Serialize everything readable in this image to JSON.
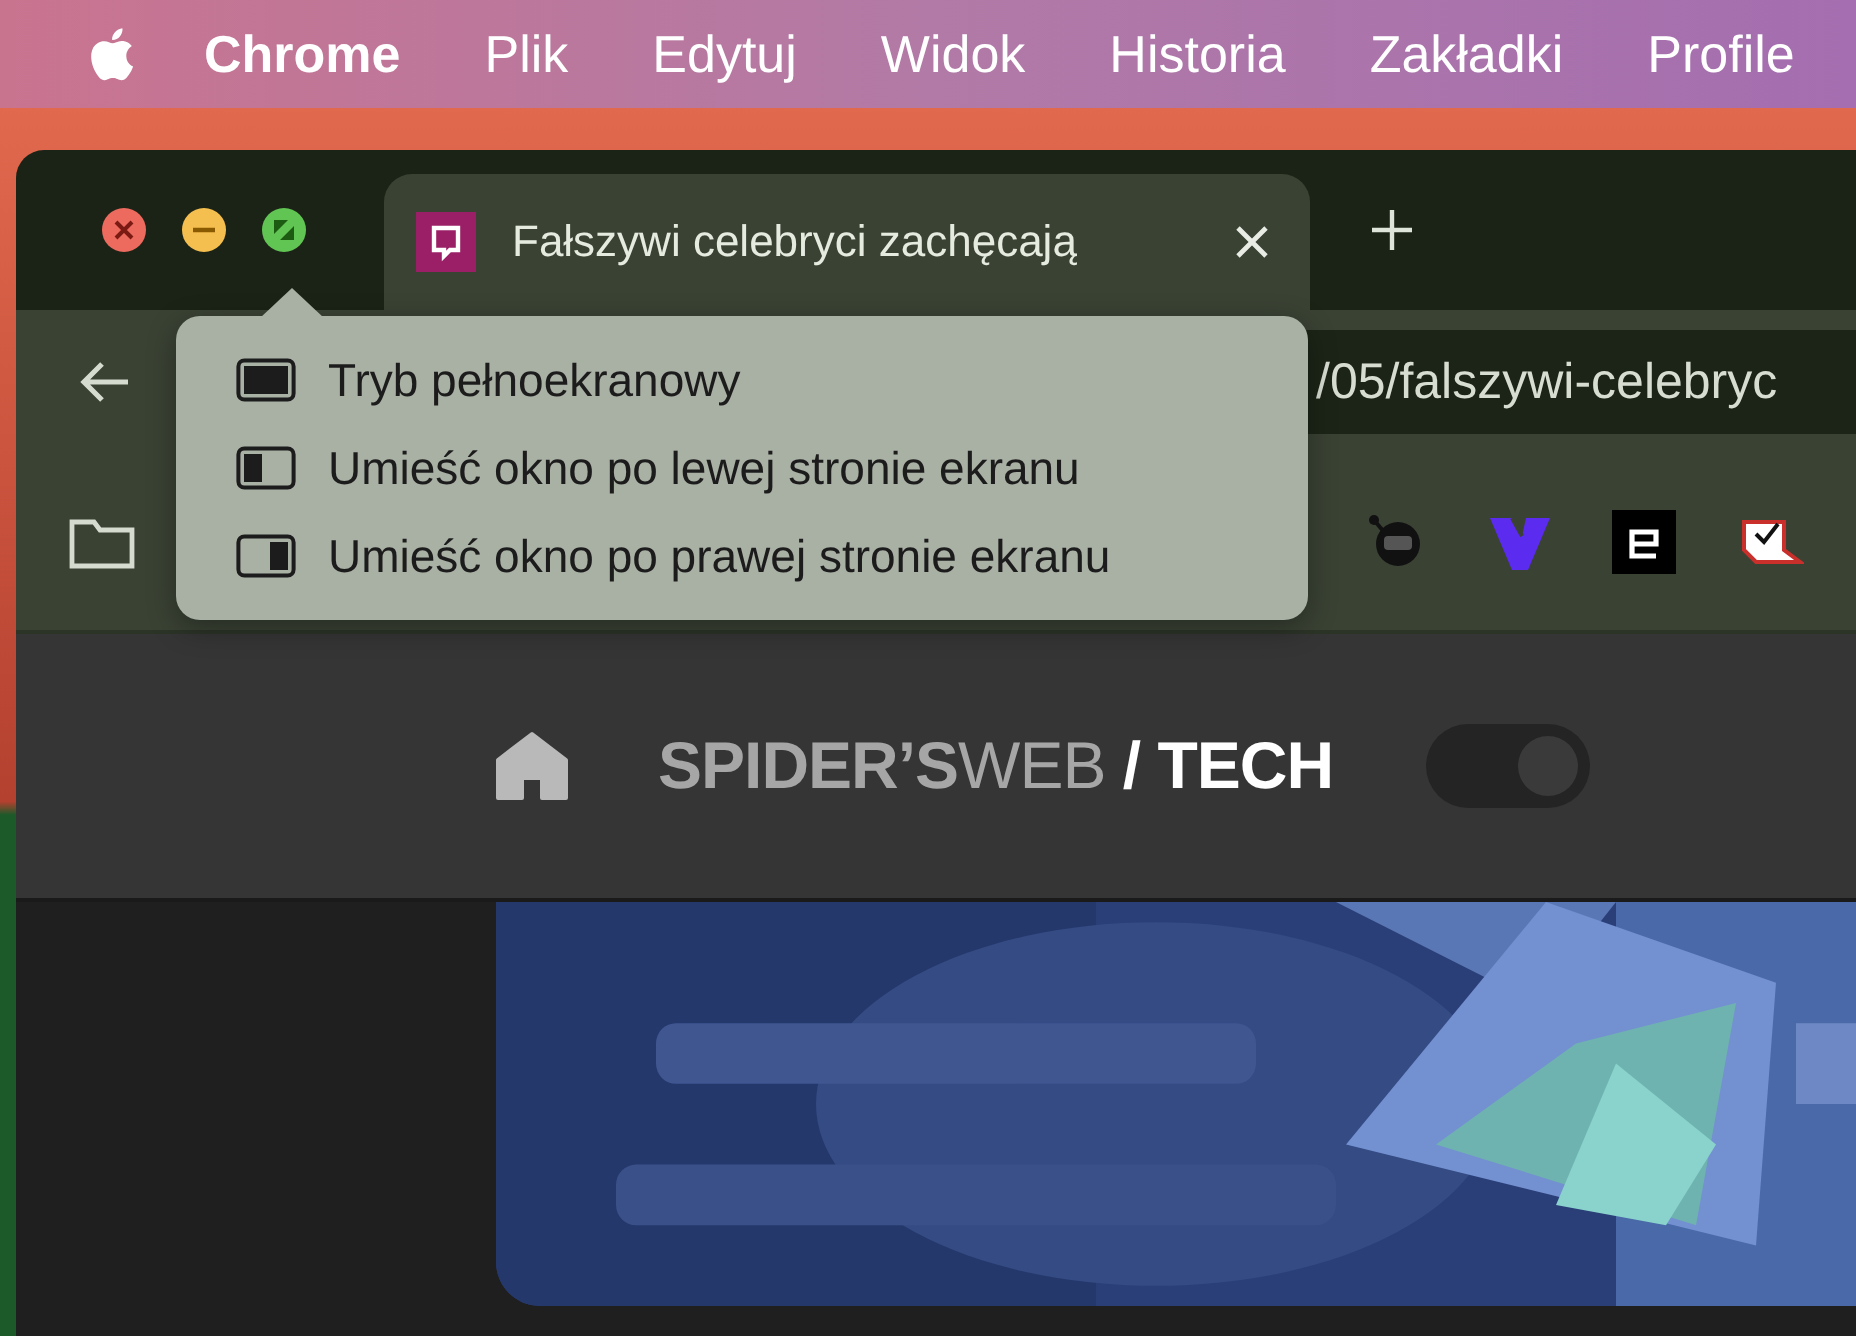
{
  "menu_bar": {
    "items": [
      {
        "label": "Chrome",
        "kind": "app"
      },
      {
        "label": "Plik",
        "kind": "menu"
      },
      {
        "label": "Edytuj",
        "kind": "menu"
      },
      {
        "label": "Widok",
        "kind": "menu"
      },
      {
        "label": "Historia",
        "kind": "menu"
      },
      {
        "label": "Zakładki",
        "kind": "menu"
      },
      {
        "label": "Profile",
        "kind": "menu"
      }
    ]
  },
  "tab": {
    "title": "Fałszywi celebryci zachęcają",
    "selected": true
  },
  "window_menu": {
    "items": [
      {
        "label": "Tryb pełnoekranowy",
        "kind": "fullscreen"
      },
      {
        "label": "Umieść okno po lewej stronie ekranu",
        "kind": "left"
      },
      {
        "label": "Umieść okno po prawej stronie ekranu",
        "kind": "right"
      }
    ]
  },
  "address_bar": {
    "value": "/05/falszywi-celebryc"
  },
  "site_header": {
    "logo": {
      "part_1": "SPIDER’S",
      "part_2": "WEB",
      "part_3": "/ TECH"
    },
    "dark_mode": {
      "on": true
    }
  }
}
